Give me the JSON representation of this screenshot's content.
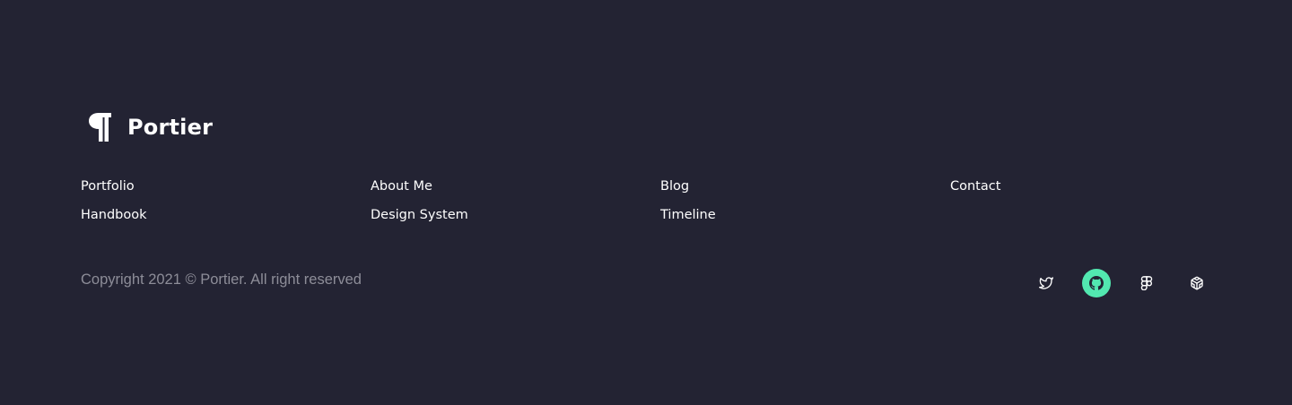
{
  "brand": {
    "name": "Portier",
    "mark_icon": "pilcrow-icon"
  },
  "nav": {
    "col1": [
      "Portfolio",
      "Handbook"
    ],
    "col2": [
      "About Me",
      "Design System"
    ],
    "col3": [
      "Blog",
      "Timeline"
    ],
    "col4": [
      "Contact"
    ]
  },
  "copyright": "Copyright 2021 © Portier. All right reserved",
  "social": [
    {
      "icon": "twitter-icon",
      "active": false
    },
    {
      "icon": "github-icon",
      "active": true
    },
    {
      "icon": "figma-icon",
      "active": false
    },
    {
      "icon": "codesandbox-icon",
      "active": false
    }
  ],
  "colors": {
    "background": "#232333",
    "text": "#ffffff",
    "muted": "#8d8d98",
    "accent": "#52e8b0"
  }
}
